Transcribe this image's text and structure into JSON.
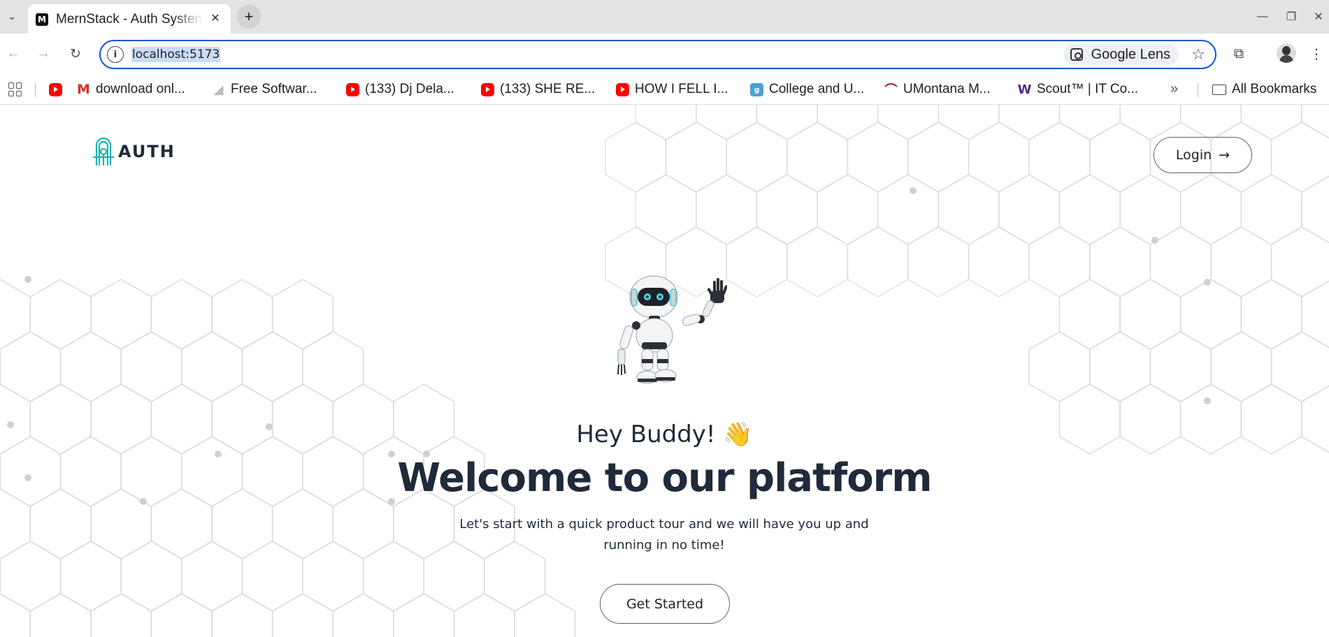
{
  "browser": {
    "tab": {
      "title": "MernStack - Auth System",
      "favicon_letter": "M"
    },
    "new_tab_label": "+",
    "address": {
      "url": "localhost:5173",
      "lens_label": "Google Lens"
    },
    "bookmarks": [
      {
        "label": "",
        "icon": "youtube-icon"
      },
      {
        "label": "download onl...",
        "icon": "m-icon"
      },
      {
        "label": "Free Softwar...",
        "icon": "software-icon"
      },
      {
        "label": "(133) Dj Dela...",
        "icon": "youtube-icon"
      },
      {
        "label": "(133) SHE RE...",
        "icon": "youtube-icon"
      },
      {
        "label": "HOW I FELL I...",
        "icon": "youtube-icon"
      },
      {
        "label": "College and U...",
        "icon": "g-icon"
      },
      {
        "label": "UMontana M...",
        "icon": "umontana-icon"
      },
      {
        "label": "Scout™ | IT Co...",
        "icon": "w-icon"
      }
    ],
    "more_label": "»",
    "all_bookmarks_label": "All Bookmarks"
  },
  "header": {
    "logo_text": "AUTH",
    "login_label": "Login"
  },
  "hero": {
    "greeting": "Hey Buddy! 👋",
    "headline": "Welcome to our platform",
    "description": "Let's start with a quick product tour and we will have you up and running in no time!",
    "cta_label": "Get Started"
  },
  "colors": {
    "accent": "#0b57d0",
    "text_dark": "#1f2a3a",
    "logo_teal": "#1fb5b0",
    "pattern": "#d9d9d9"
  }
}
